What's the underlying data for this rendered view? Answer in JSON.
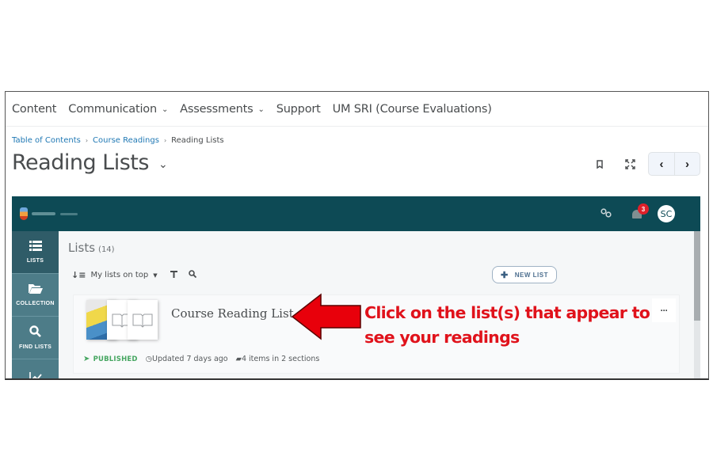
{
  "topnav": {
    "items": [
      {
        "label": "Content",
        "has_dropdown": false
      },
      {
        "label": "Communication",
        "has_dropdown": true
      },
      {
        "label": "Assessments",
        "has_dropdown": true
      },
      {
        "label": "Support",
        "has_dropdown": false
      },
      {
        "label": "UM SRI (Course Evaluations)",
        "has_dropdown": false
      }
    ]
  },
  "breadcrumb": {
    "items": [
      "Table of Contents",
      "Course Readings"
    ],
    "current": "Reading Lists"
  },
  "page": {
    "title": "Reading Lists",
    "title_chevron": "⌄",
    "tools": {
      "bookmark_icon": "bookmark-icon",
      "fullscreen_icon": "fullscreen-icon",
      "prev": "‹",
      "next": "›"
    }
  },
  "app": {
    "header": {
      "notification_count": "3",
      "avatar_initials": "SC"
    },
    "sidebar": [
      {
        "label": "LISTS",
        "icon": "≣",
        "active": true
      },
      {
        "label": "COLLECTION",
        "icon": "▰",
        "active": false
      },
      {
        "label": "FIND LISTS",
        "icon": "⚲",
        "active": false
      },
      {
        "label": "",
        "icon": "↗",
        "active": false
      }
    ],
    "lists": {
      "title": "Lists",
      "count": "(14)",
      "sort_label": "My lists on top",
      "new_list_label": "NEW LIST",
      "cards": [
        {
          "title": "Course Reading List",
          "status": "PUBLISHED",
          "updated": "Updated 7 days ago",
          "items": "4 items in 2 sections",
          "more": "···"
        }
      ]
    }
  },
  "annotation": {
    "line1": "Click on the list(s) that appear to",
    "line2": "see your readings",
    "color": "#e0121b"
  }
}
